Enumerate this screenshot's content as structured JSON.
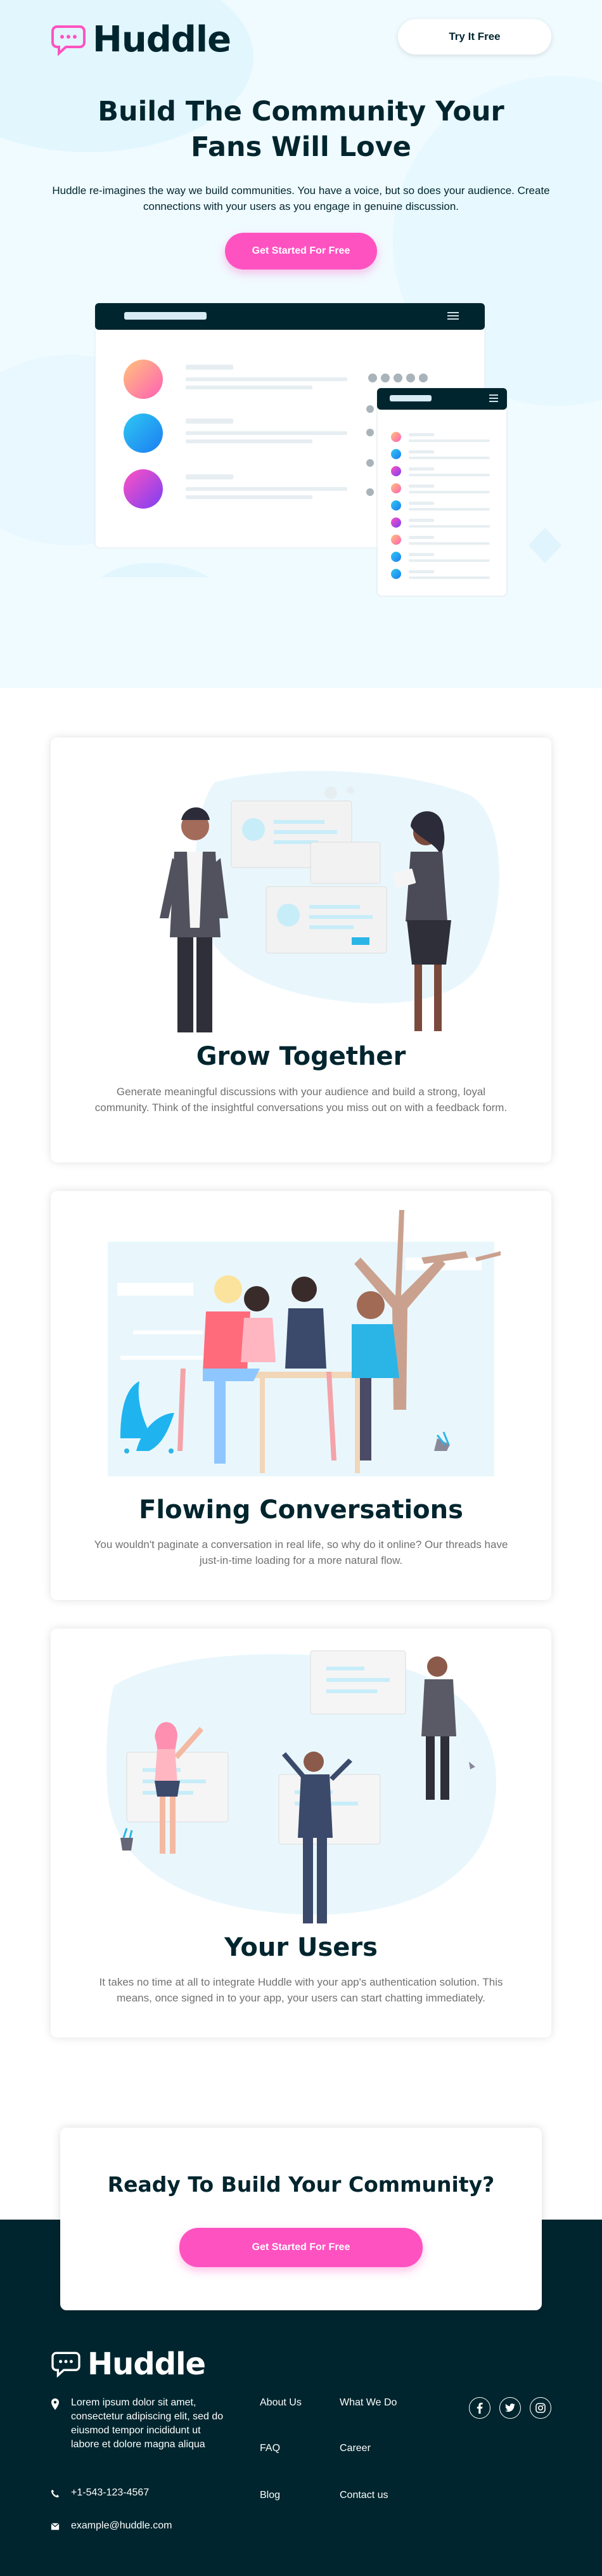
{
  "header": {
    "logo_text": "Huddle",
    "try_label": "Try It Free"
  },
  "hero": {
    "title": "Build The Community Your Fans Will Love",
    "subtitle": "Huddle re-imagines the way we build communities. You have a voice, but so does your audience. Create connections with your users as you engage in genuine discussion.",
    "cta_label": "Get Started For Free"
  },
  "features": [
    {
      "title": "Grow Together",
      "text": "Generate meaningful discussions with your audience and build a strong, loyal community. Think of the insightful conversations you miss out on with a feedback form."
    },
    {
      "title": "Flowing Conversations",
      "text": "You wouldn't paginate a conversation in real life, so why do it online? Our threads have just-in-time loading for a more natural flow."
    },
    {
      "title": "Your Users",
      "text": "It takes no time at all to integrate Huddle with your app's authentication solution. This means, once signed in to your app, your users can start chatting immediately."
    }
  ],
  "ready": {
    "title": "Ready To Build Your Community?",
    "cta_label": "Get Started For Free"
  },
  "footer": {
    "logo_text": "Huddle",
    "address": "Lorem ipsum dolor sit amet, consectetur adipiscing elit, sed do eiusmod tempor incididunt ut labore et dolore magna aliqua",
    "phone": "+1-543-123-4567",
    "email": "example@huddle.com",
    "links_col1": [
      "About Us",
      "FAQ",
      "Blog"
    ],
    "links_col2": [
      "What We Do",
      "Career",
      "Contact us"
    ],
    "social_icons": [
      "facebook-icon",
      "twitter-icon",
      "instagram-icon"
    ]
  },
  "colors": {
    "brand_pink": "#ff52c1",
    "dark_cyan": "#00252e",
    "hero_bg": "#f0fbff",
    "text_gray": "#717171"
  }
}
